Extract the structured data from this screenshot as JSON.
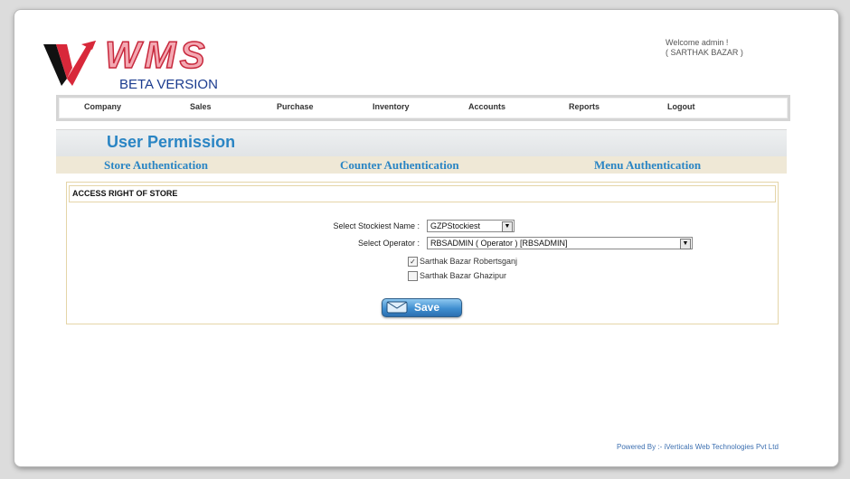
{
  "header": {
    "logo_text": "WMS",
    "logo_subtitle": "BETA VERSION",
    "welcome_line1": "Welcome admin !",
    "welcome_line2": "( SARTHAK BAZAR )"
  },
  "menu": {
    "items": [
      {
        "label": "Company"
      },
      {
        "label": "Sales"
      },
      {
        "label": "Purchase"
      },
      {
        "label": "Inventory"
      },
      {
        "label": "Accounts"
      },
      {
        "label": "Reports"
      },
      {
        "label": "Logout"
      }
    ]
  },
  "page": {
    "title": "User Permission",
    "tabs": [
      {
        "label": "Store Authentication"
      },
      {
        "label": "Counter Authentication"
      },
      {
        "label": "Menu Authentication"
      }
    ]
  },
  "panel": {
    "heading": "ACCESS RIGHT OF STORE",
    "stockiest_label": "Select Stockiest Name :",
    "stockiest_value": "GZPStockiest",
    "operator_label": "Select Operator :",
    "operator_value": "RBSADMIN ( Operator ) [RBSADMIN]",
    "stores": [
      {
        "label": "Sarthak Bazar Robertsganj",
        "checked": true
      },
      {
        "label": "Sarthak Bazar Ghazipur",
        "checked": false
      }
    ],
    "save_label": "Save"
  },
  "footer": {
    "text": "Powered By :- iVerticals Web Technologies Pvt Ltd"
  },
  "colors": {
    "accent_blue": "#2a85c4",
    "logo_red": "#c7283c",
    "tab_band": "#efe8d6"
  },
  "icons": {
    "logo": "v-logo-mark",
    "save": "envelope-icon",
    "dropdown": "dropdown-arrow-icon",
    "checkbox_checked": "checkmark-icon"
  }
}
